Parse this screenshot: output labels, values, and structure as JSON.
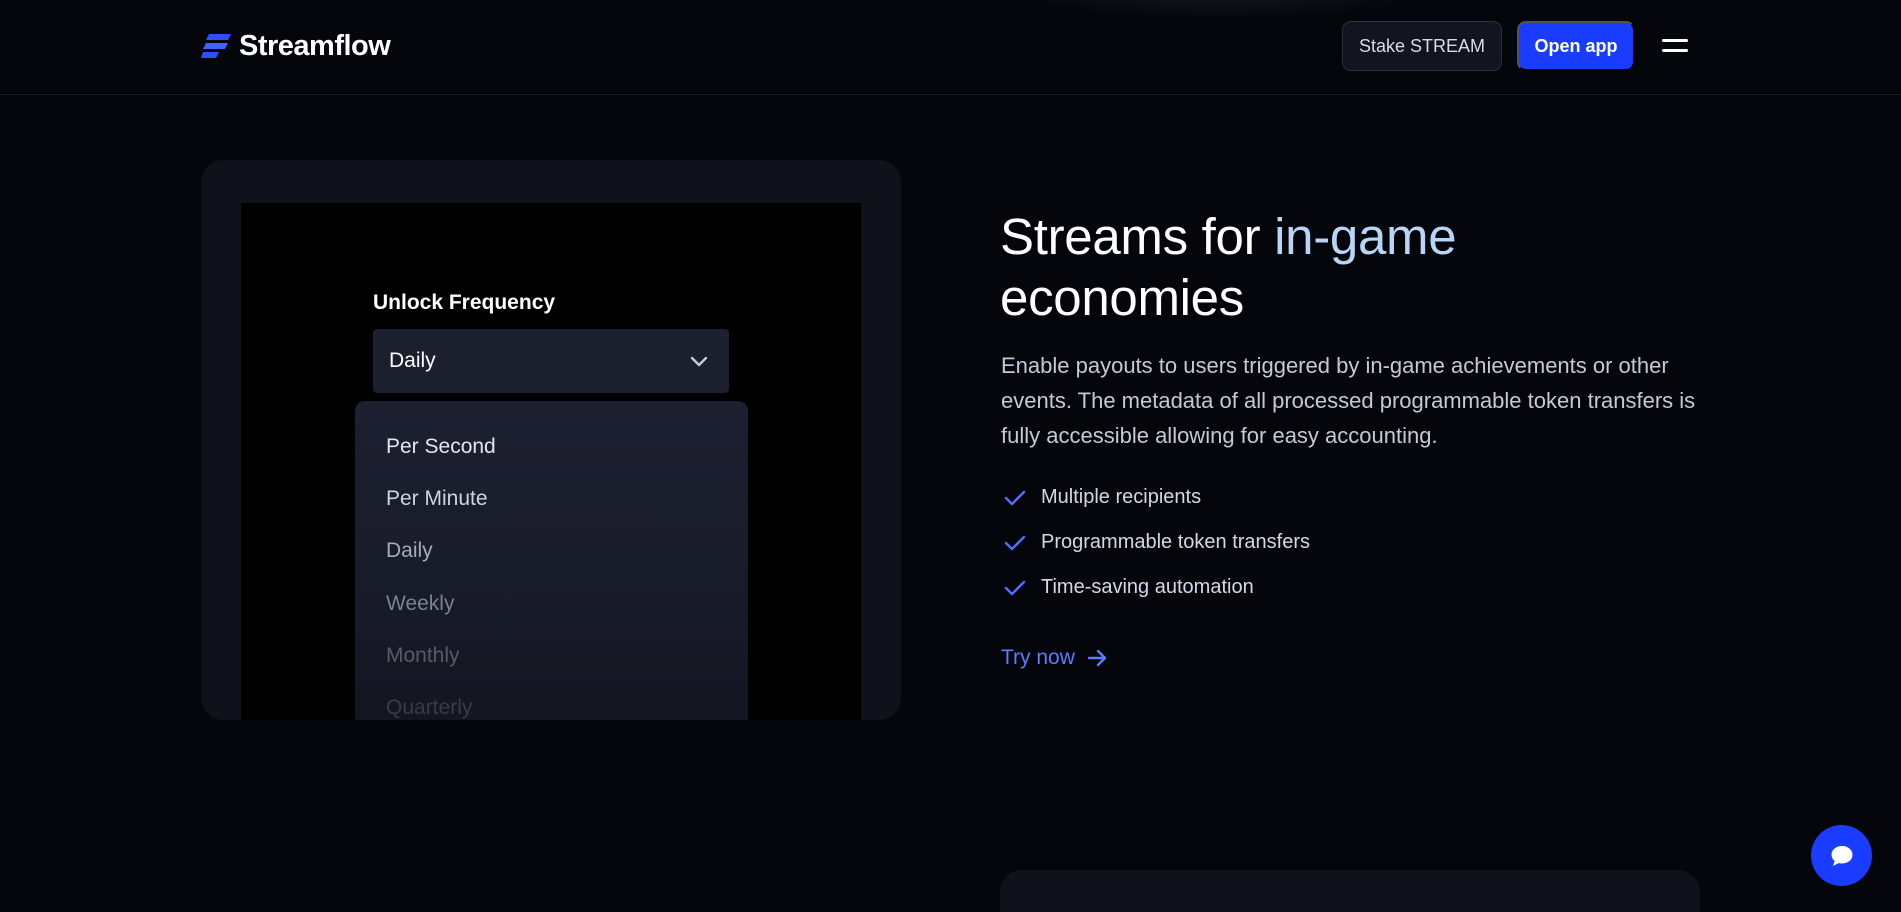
{
  "header": {
    "brand": "Streamflow",
    "stake_label": "Stake STREAM",
    "open_app_label": "Open app",
    "menu_icon": "hamburger-icon"
  },
  "illustration": {
    "label": "Unlock Frequency",
    "selected": "Daily",
    "options": [
      "Per Second",
      "Per Minute",
      "Daily",
      "Weekly",
      "Monthly",
      "Quarterly"
    ]
  },
  "content": {
    "headline_part1": "Streams for ",
    "headline_accent": "in-game",
    "headline_part2": "economies",
    "description": "Enable payouts to users triggered by in-game achievements or other events. The metadata of all processed programmable token transfers is fully accessible allowing for easy accounting.",
    "features": [
      "Multiple recipients",
      "Programmable token transfers",
      "Time-saving automation"
    ],
    "cta_label": "Try now"
  },
  "colors": {
    "background": "#05060c",
    "accent_blue": "#1a3cff",
    "link_blue": "#5a7cff",
    "headline_accent": "#b8d5f5"
  }
}
